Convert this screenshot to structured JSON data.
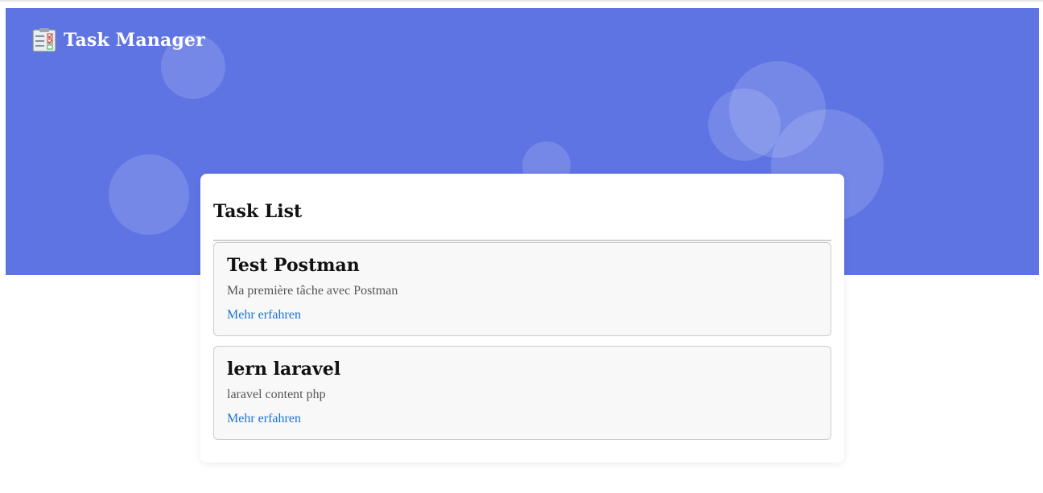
{
  "header": {
    "title": "Task Manager",
    "icon": "clipboard-icon",
    "background_color": "#5f74e3"
  },
  "task_list": {
    "title": "Task List",
    "tasks": [
      {
        "title": "Test Postman",
        "description": "Ma première tâche avec Postman",
        "link_label": "Mehr erfahren"
      },
      {
        "title": "lern laravel",
        "description": "laravel content php",
        "link_label": "Mehr erfahren"
      }
    ]
  },
  "colors": {
    "accent": "#5f74e3",
    "link": "#1a73d9",
    "card_bg": "#ffffff",
    "task_bg": "#f8f8f8"
  }
}
